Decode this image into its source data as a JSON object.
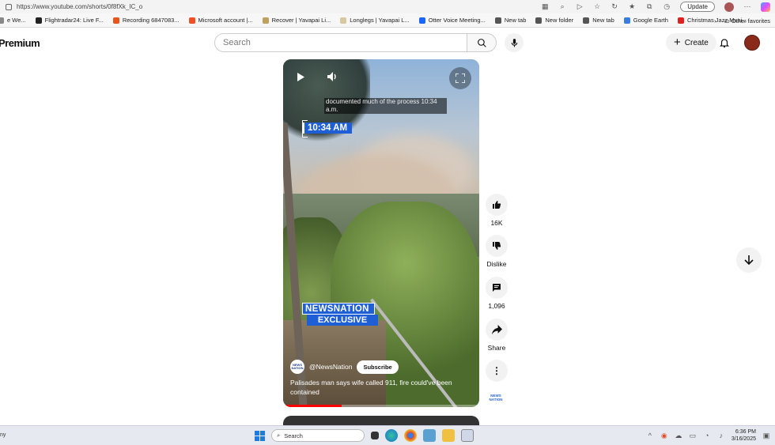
{
  "browser": {
    "url": "https://www.youtube.com/shorts/0f8fXk_IC_o",
    "update_label": "Update",
    "bookmarks": [
      {
        "label": "e We...",
        "color": "#888888"
      },
      {
        "label": "Flightradar24: Live F...",
        "color": "#222222"
      },
      {
        "label": "Recording 6847083...",
        "color": "#e8541c"
      },
      {
        "label": "Microsoft account |...",
        "color": "#f25022"
      },
      {
        "label": "Recover | Yavapai Li...",
        "color": "#c0a060"
      },
      {
        "label": "Longlegs | Yavapai L...",
        "color": "#d8c8a0"
      },
      {
        "label": "Otter Voice Meeting...",
        "color": "#1a66ff"
      },
      {
        "label": "New tab",
        "color": "#555555"
      },
      {
        "label": "New folder",
        "color": "#555555"
      },
      {
        "label": "New tab",
        "color": "#555555"
      },
      {
        "label": "Google Earth",
        "color": "#3a7de0"
      },
      {
        "label": "Christmas Jazz Musi...",
        "color": "#e02020"
      }
    ],
    "other_favorites": "Other favorites"
  },
  "youtube": {
    "logo_text": "Premium",
    "search_placeholder": "Search",
    "create_label": "Create"
  },
  "video": {
    "caption": "documented much of the process 10:34 a.m.",
    "time_badge": "10:34 AM",
    "network_top": "NEWSNATION",
    "network_bottom": "EXCLUSIVE",
    "channel_avatar_text": "NEWS NATION",
    "channel_name": "@NewsNation",
    "subscribe_label": "Subscribe",
    "title": "Palisades man says wife called 911, fire could've been contained",
    "progress_fraction": 0.3
  },
  "actions": {
    "like_count": "16K",
    "dislike_label": "Dislike",
    "comment_count": "1,096",
    "share_label": "Share",
    "channel_small_text": "NEWS NATION"
  },
  "taskbar": {
    "left_text": "ny",
    "search_label": "Search",
    "time": "6:36 PM",
    "date": "3/16/2025"
  },
  "colors": {
    "accent_blue": "#1f5fd6",
    "progress_red": "#ff0000"
  }
}
